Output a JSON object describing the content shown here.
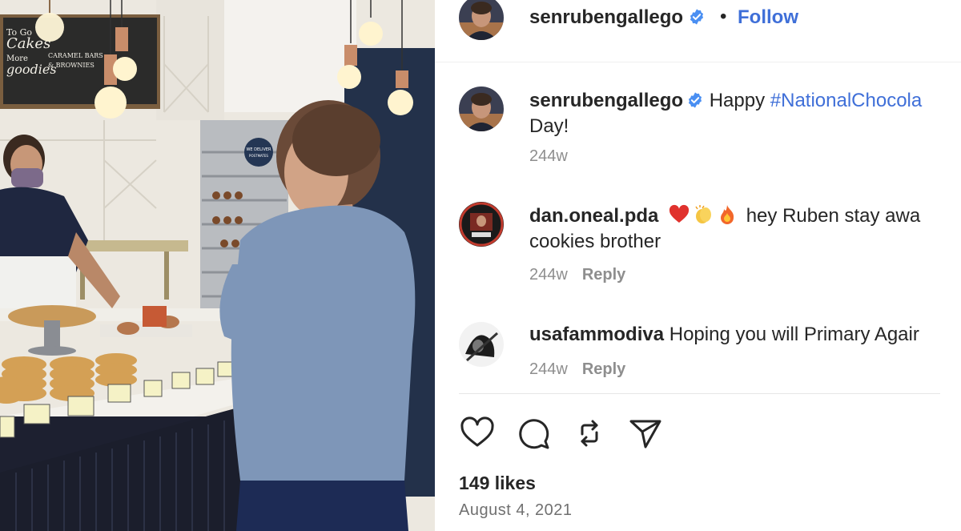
{
  "photo": {
    "sign_text": [
      "To Go",
      "Cakes",
      "More",
      "goodies",
      "CARAMEL BARS",
      "& BROWNIES"
    ],
    "badge_text": [
      "WE DELIVER",
      "POSTMATES"
    ]
  },
  "post": {
    "username": "senrubengallego",
    "separator": "•",
    "follow_label": "Follow"
  },
  "comments": [
    {
      "username": "senrubengallego",
      "text_before": " Happy ",
      "hashtag": "#NationalChocola",
      "line2": "Day!",
      "time": "244w",
      "reply": ""
    },
    {
      "username": "dan.oneal.pda",
      "emojis": [
        "heart-emoji",
        "clapping-emoji",
        "fire-emoji"
      ],
      "text": "hey Ruben stay awa",
      "line2": "cookies brother",
      "time": "244w",
      "reply": "Reply"
    },
    {
      "username": "usafammodiva",
      "text": " Hoping you will Primary Agair",
      "time": "244w",
      "reply": "Reply"
    }
  ],
  "actions": {
    "icons": [
      "heart-icon",
      "comment-icon",
      "repost-icon",
      "share-icon"
    ]
  },
  "likes": "149 likes",
  "date": "August 4, 2021",
  "colors": {
    "link_blue": "#3f6fd8",
    "verified_blue": "#4a8ff2",
    "meta_gray": "#8e8e8e"
  }
}
